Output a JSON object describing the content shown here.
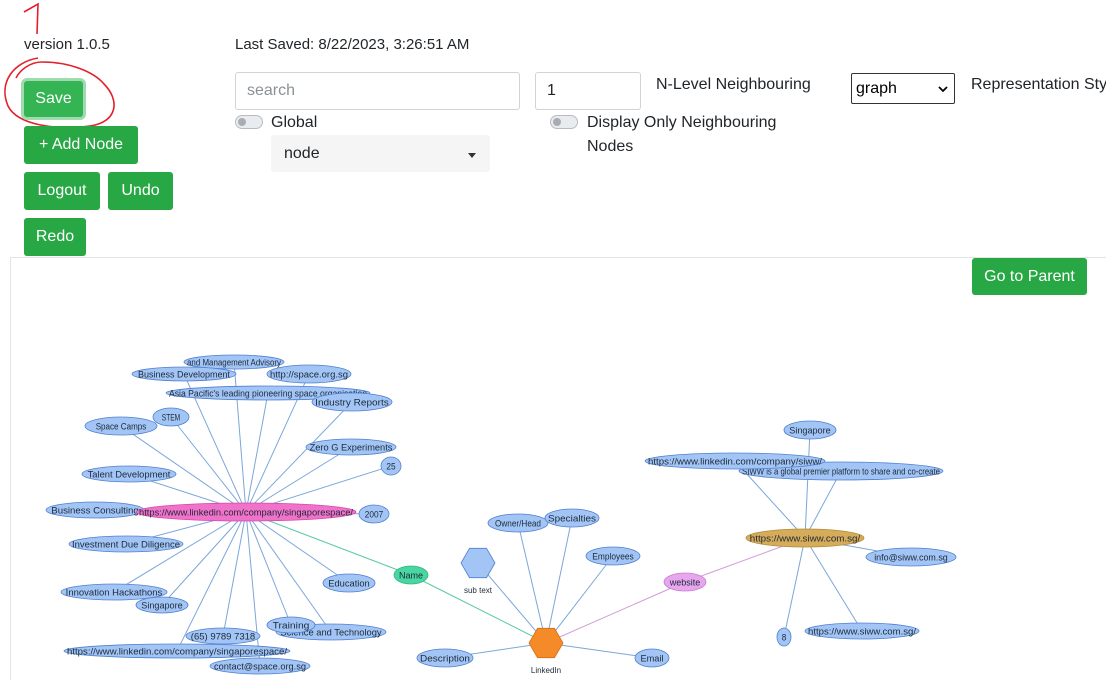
{
  "header": {
    "version": "version 1.0.5",
    "last_saved": "Last Saved: 8/22/2023, 3:26:51 AM",
    "annotation_number": "1"
  },
  "buttons": {
    "save": "Save",
    "add_node": "+ Add Node",
    "logout": "Logout",
    "undo": "Undo",
    "redo": "Redo",
    "go_to_parent": "Go to Parent"
  },
  "search": {
    "placeholder": "search",
    "value": ""
  },
  "level": {
    "value": "1",
    "label": "N-Level Neighbouring"
  },
  "toggles": {
    "global_label": "Global",
    "neighbouring_label_1": "Display Only Neighbouring",
    "neighbouring_label_2": "Nodes"
  },
  "node_type_dropdown": {
    "selected": "node"
  },
  "representation": {
    "selected": "graph",
    "label": "Representation Styl"
  },
  "colors": {
    "button_green": "#28a745",
    "node_blue": "#a3c5f5",
    "node_blue_border": "#4f7fd0",
    "name_node": "#4ad6a1",
    "website_node": "#e8a6ee",
    "space_center": "#f072c9",
    "siww_center": "#d6ab5a",
    "linkedin_hex": "#f48a28",
    "edge_blue": "#7ba7da",
    "edge_green": "#59c9a3",
    "edge_pink": "#d09bd5",
    "annotation_red": "#e3202b"
  },
  "graph": {
    "edges": [
      {
        "from": "space",
        "to": "n_mgmt",
        "kind": "blue"
      },
      {
        "from": "space",
        "to": "n_bizdev",
        "kind": "blue"
      },
      {
        "from": "space",
        "to": "n_spaceorg",
        "kind": "blue"
      },
      {
        "from": "space",
        "to": "n_asiapac",
        "kind": "blue"
      },
      {
        "from": "space",
        "to": "n_industry",
        "kind": "blue"
      },
      {
        "from": "space",
        "to": "n_stem",
        "kind": "blue"
      },
      {
        "from": "space",
        "to": "n_camps",
        "kind": "blue"
      },
      {
        "from": "space",
        "to": "n_zerog",
        "kind": "blue"
      },
      {
        "from": "space",
        "to": "n_25",
        "kind": "blue"
      },
      {
        "from": "space",
        "to": "n_talent",
        "kind": "blue"
      },
      {
        "from": "space",
        "to": "n_bizcon",
        "kind": "blue"
      },
      {
        "from": "space",
        "to": "n_2007",
        "kind": "blue"
      },
      {
        "from": "space",
        "to": "n_invest",
        "kind": "blue"
      },
      {
        "from": "space",
        "to": "n_innov",
        "kind": "blue"
      },
      {
        "from": "space",
        "to": "n_sgp1",
        "kind": "blue"
      },
      {
        "from": "space",
        "to": "n_edu",
        "kind": "blue"
      },
      {
        "from": "space",
        "to": "n_phone",
        "kind": "blue"
      },
      {
        "from": "space",
        "to": "n_training",
        "kind": "blue"
      },
      {
        "from": "space",
        "to": "n_scitech",
        "kind": "blue"
      },
      {
        "from": "space",
        "to": "n_linkedin2",
        "kind": "blue"
      },
      {
        "from": "space",
        "to": "n_contact",
        "kind": "blue"
      },
      {
        "from": "space",
        "to": "n_name",
        "kind": "green"
      },
      {
        "from": "n_name",
        "to": "linkedin",
        "kind": "green"
      },
      {
        "from": "linkedin",
        "to": "n_owner",
        "kind": "blue"
      },
      {
        "from": "linkedin",
        "to": "n_special",
        "kind": "blue"
      },
      {
        "from": "linkedin",
        "to": "n_employees",
        "kind": "blue"
      },
      {
        "from": "linkedin",
        "to": "n_subhex",
        "kind": "blue"
      },
      {
        "from": "linkedin",
        "to": "n_desc",
        "kind": "blue"
      },
      {
        "from": "linkedin",
        "to": "n_email",
        "kind": "blue"
      },
      {
        "from": "linkedin",
        "to": "n_website",
        "kind": "pink"
      },
      {
        "from": "n_website",
        "to": "siww",
        "kind": "pink"
      },
      {
        "from": "siww",
        "to": "n_sgp2",
        "kind": "blue"
      },
      {
        "from": "siww",
        "to": "n_siwwli",
        "kind": "blue"
      },
      {
        "from": "siww",
        "to": "n_siwwdesc",
        "kind": "blue"
      },
      {
        "from": "siww",
        "to": "n_info",
        "kind": "blue"
      },
      {
        "from": "siww",
        "to": "n_8",
        "kind": "blue"
      },
      {
        "from": "siww",
        "to": "n_siwwurl",
        "kind": "blue"
      }
    ],
    "nodes": [
      {
        "id": "n_mgmt",
        "label": "and Management Advisory",
        "kind": "blue"
      },
      {
        "id": "n_bizdev",
        "label": "Business Development",
        "kind": "blue"
      },
      {
        "id": "n_spaceorg",
        "label": "http://space.org.sg",
        "kind": "blue"
      },
      {
        "id": "n_asiapac",
        "label": "Asia Pacific's leading pioneering space organisation",
        "kind": "blue"
      },
      {
        "id": "n_industry",
        "label": "Industry Reports",
        "kind": "blue"
      },
      {
        "id": "n_stem",
        "label": "STEM",
        "kind": "blue"
      },
      {
        "id": "n_camps",
        "label": "Space Camps",
        "kind": "blue"
      },
      {
        "id": "n_zerog",
        "label": "Zero G Experiments",
        "kind": "blue"
      },
      {
        "id": "n_25",
        "label": "25",
        "kind": "blue"
      },
      {
        "id": "n_talent",
        "label": "Talent Development",
        "kind": "blue"
      },
      {
        "id": "n_bizcon",
        "label": "Business Consulting",
        "kind": "blue"
      },
      {
        "id": "space",
        "label": "https://www.linkedin.com/company/singaporespace/",
        "kind": "space"
      },
      {
        "id": "n_2007",
        "label": "2007",
        "kind": "blue"
      },
      {
        "id": "n_invest",
        "label": "Investment Due Diligence",
        "kind": "blue"
      },
      {
        "id": "n_innov",
        "label": "Innovation Hackathons",
        "kind": "blue"
      },
      {
        "id": "n_sgp1",
        "label": "Singapore",
        "kind": "blue"
      },
      {
        "id": "n_edu",
        "label": "Education",
        "kind": "blue"
      },
      {
        "id": "n_scitech",
        "label": "Science and Technology",
        "kind": "blue"
      },
      {
        "id": "n_training",
        "label": "Training",
        "kind": "blue"
      },
      {
        "id": "n_phone",
        "label": "(65) 9789 7318",
        "kind": "blue"
      },
      {
        "id": "n_linkedin2",
        "label": "https://www.linkedin.com/company/singaporespace/",
        "kind": "blue"
      },
      {
        "id": "n_contact",
        "label": "contact@space.org.sg",
        "kind": "blue"
      },
      {
        "id": "n_name",
        "label": "Name",
        "kind": "name"
      },
      {
        "id": "n_subhex",
        "label": "sub text",
        "kind": "hex_blue"
      },
      {
        "id": "n_owner",
        "label": "Owner/Head",
        "kind": "blue"
      },
      {
        "id": "n_special",
        "label": "Specialties",
        "kind": "blue"
      },
      {
        "id": "n_employees",
        "label": "Employees",
        "kind": "blue"
      },
      {
        "id": "n_website",
        "label": "website",
        "kind": "website"
      },
      {
        "id": "n_desc",
        "label": "Description",
        "kind": "blue"
      },
      {
        "id": "n_email",
        "label": "Email",
        "kind": "blue"
      },
      {
        "id": "linkedin",
        "label": "LinkedIn",
        "kind": "hex_orange"
      },
      {
        "id": "n_sgp2",
        "label": "Singapore",
        "kind": "blue"
      },
      {
        "id": "n_siwwdesc",
        "label": "SIWW is a global premier platform to share and co-create",
        "kind": "blue"
      },
      {
        "id": "n_siwwli",
        "label": "https://www.linkedin.com/company/siww/",
        "kind": "blue"
      },
      {
        "id": "siww",
        "label": "https://www.siww.com.sg/",
        "kind": "siww"
      },
      {
        "id": "n_info",
        "label": "info@siww.com.sg",
        "kind": "blue"
      },
      {
        "id": "n_8",
        "label": "8",
        "kind": "blue"
      },
      {
        "id": "n_siwwurl",
        "label": "https://www.siww.com.sg/",
        "kind": "blue"
      }
    ]
  }
}
